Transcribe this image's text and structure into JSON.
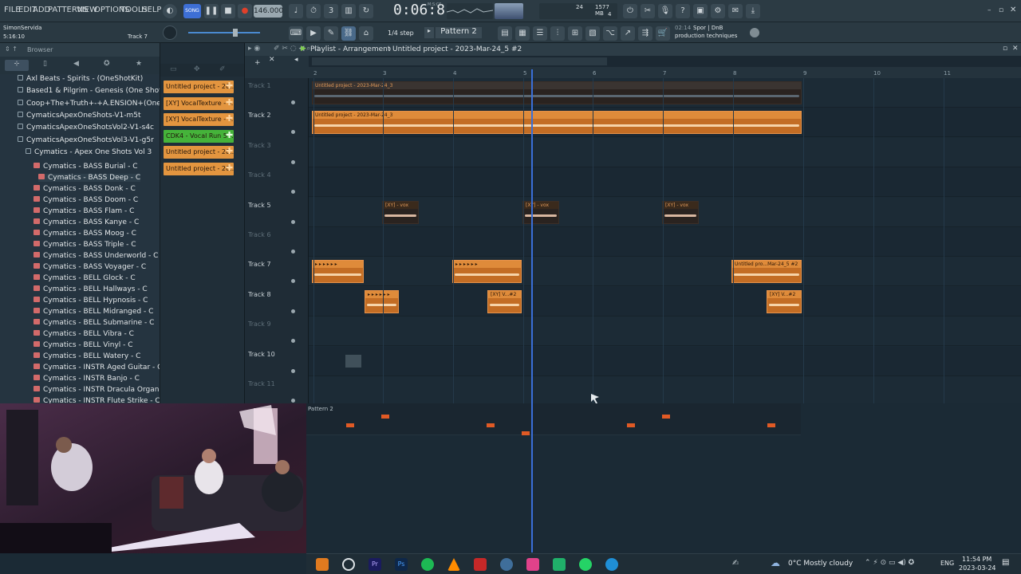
{
  "menu": [
    "FILE",
    "EDIT",
    "ADD",
    "PATTERNS",
    "VIEW",
    "OPTIONS",
    "TOOLS",
    "HELP"
  ],
  "transport": {
    "song_mode": "SONG",
    "tempo": "146.000",
    "time": "0:06:81",
    "time_label": "M:S:CS",
    "cpu": "24",
    "ram": "1577 MB",
    "voices": "4"
  },
  "toolbar": {
    "step": "1/4 step",
    "pattern": "Pattern 2",
    "hint_num": "02:14",
    "hint_text_1": "Spor | DnB",
    "hint_text_2": "production techniques"
  },
  "user": {
    "name": "SimonServida",
    "position": "5:16:10",
    "track": "Track 7"
  },
  "browser": {
    "title": "Browser",
    "items": [
      "Axl Beats - Spirits - (OneShotKit)",
      "Based1 & Pilgrim - Genesis (One Shot Kit)",
      "Coop+The+Truth+-+A.ENSION+(One+Shots)",
      "CymaticsApexOneShots-V1-m5t",
      "CymaticsApexOneShotsVol2-V1-s4c",
      "CymaticsApexOneShotsVol3-V1-g5r",
      "Cymatics - Apex One Shots Vol 3",
      "Cymatics - BASS Burial - C",
      "Cymatics - BASS Deep - C",
      "Cymatics - BASS Donk - C",
      "Cymatics - BASS Doom - C",
      "Cymatics - BASS Flam - C",
      "Cymatics - BASS Kanye - C",
      "Cymatics - BASS Moog - C",
      "Cymatics - BASS Triple - C",
      "Cymatics - BASS Underworld - C",
      "Cymatics - BASS Voyager - C",
      "Cymatics - BELL Glock - C",
      "Cymatics - BELL Hallways - C",
      "Cymatics - BELL Hypnosis - C",
      "Cymatics - BELL Midranged - C",
      "Cymatics - BELL Submarine - C",
      "Cymatics - BELL Vibra - C",
      "Cymatics - BELL Vinyl - C",
      "Cymatics - BELL Watery - C",
      "Cymatics - INSTR Aged Guitar - C",
      "Cymatics - INSTR Banjo - C",
      "Cymatics - INSTR Dracula Organ - C",
      "Cymatics - INSTR Flute Strike - C"
    ]
  },
  "channels": [
    {
      "label": "Untitled project - 20...",
      "color": "#e3953f"
    },
    {
      "label": "[XY] VocalTexture - v...",
      "color": "#e3953f"
    },
    {
      "label": "[XY] VocalTexture - v...",
      "color": "#e3953f"
    },
    {
      "label": "CDK4 - Vocal Run 5 -...",
      "color": "#45b33a"
    },
    {
      "label": "Untitled project - 20...",
      "color": "#e3953f"
    },
    {
      "label": "Untitled project - 20...",
      "color": "#e3953f"
    }
  ],
  "playlist": {
    "title": "Playlist - Arrangement",
    "project": "Untitled project - 2023-Mar-24_5 #2",
    "bars": [
      "2",
      "3",
      "4",
      "5",
      "6",
      "7",
      "8",
      "9",
      "10",
      "11"
    ],
    "tracks": [
      "Track 1",
      "Track 2",
      "Track 3",
      "Track 4",
      "Track 5",
      "Track 6",
      "Track 7",
      "Track 8",
      "Track 9",
      "Track 10",
      "Track 11"
    ],
    "clip_labels": {
      "t1": "Untitled project - 2023-Mar-24_3",
      "t2": "Untitled project - 2023-Mar-24_3",
      "vox": "[XY] - vox",
      "t7end": "Untitled pro...Mar-24_5 #2",
      "t8": "[XY] V...#2"
    }
  },
  "pattern_strip": {
    "label": "Pattern 2"
  },
  "taskbar": {
    "weather": "0°C Mostly cloudy",
    "lang": "ENG",
    "time": "11:54 PM",
    "date": "2023-03-24"
  }
}
